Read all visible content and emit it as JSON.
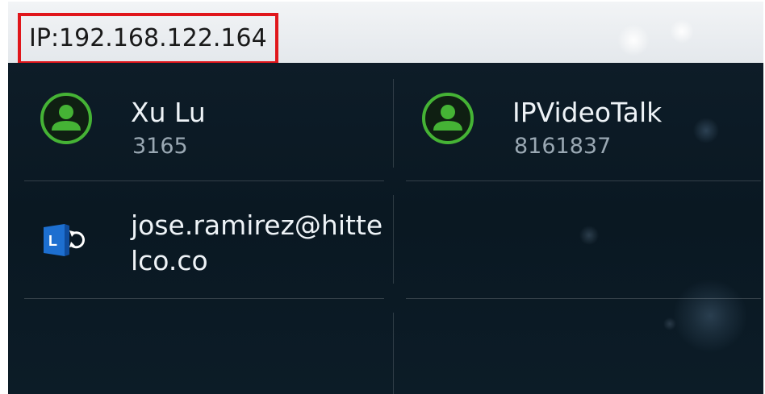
{
  "status_bar": {
    "ip_text": "IP:192.168.122.164"
  },
  "contacts": [
    {
      "name": "Xu Lu",
      "number": "3165",
      "icon": "contact-avatar-icon",
      "accent": "#45b335"
    },
    {
      "name": "IPVideoTalk",
      "number": "8161837",
      "icon": "contact-avatar-icon",
      "accent": "#45b335"
    },
    {
      "name": "jose.ramirez@hittelco.co",
      "icon": "lync-account-icon",
      "accent": "#1d6fd0"
    }
  ],
  "colors": {
    "background": "#0d1a24",
    "highlight_border": "#e0161b"
  }
}
